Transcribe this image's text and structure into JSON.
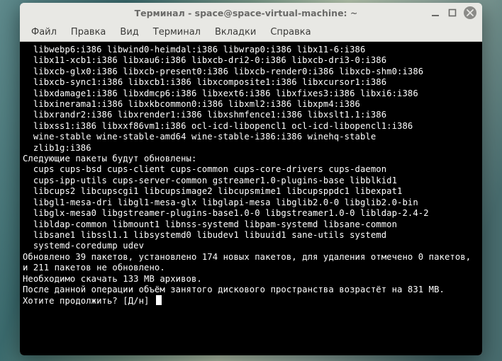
{
  "window": {
    "title": "Терминал - space@space-virtual-machine: ~"
  },
  "menu": {
    "file": "Файл",
    "edit": "Правка",
    "view": "Вид",
    "terminal": "Терминал",
    "tabs": "Вкладки",
    "help": "Справка"
  },
  "term": {
    "l01": "  libwebp6:i386 libwind0-heimdal:i386 libwrap0:i386 libx11-6:i386",
    "l02": "  libx11-xcb1:i386 libxau6:i386 libxcb-dri2-0:i386 libxcb-dri3-0:i386",
    "l03": "  libxcb-glx0:i386 libxcb-present0:i386 libxcb-render0:i386 libxcb-shm0:i386",
    "l04": "  libxcb-sync1:i386 libxcb1:i386 libxcomposite1:i386 libxcursor1:i386",
    "l05": "  libxdamage1:i386 libxdmcp6:i386 libxext6:i386 libxfixes3:i386 libxi6:i386",
    "l06": "  libxinerama1:i386 libxkbcommon0:i386 libxml2:i386 libxpm4:i386",
    "l07": "  libxrandr2:i386 libxrender1:i386 libxshmfence1:i386 libxslt1.1:i386",
    "l08": "  libxss1:i386 libxxf86vm1:i386 ocl-icd-libopencl1 ocl-icd-libopencl1:i386",
    "l09": "  wine-stable wine-stable-amd64 wine-stable-i386:i386 winehq-stable",
    "l10": "  zlib1g:i386",
    "l11": "Следующие пакеты будут обновлены:",
    "l12": "  cups cups-bsd cups-client cups-common cups-core-drivers cups-daemon",
    "l13": "  cups-ipp-utils cups-server-common gstreamer1.0-plugins-base libblkid1",
    "l14": "  libcups2 libcupscgi1 libcupsimage2 libcupsmime1 libcupsppdc1 libexpat1",
    "l15": "  libgl1-mesa-dri libgl1-mesa-glx libglapi-mesa libglib2.0-0 libglib2.0-bin",
    "l16": "  libglx-mesa0 libgstreamer-plugins-base1.0-0 libgstreamer1.0-0 libldap-2.4-2",
    "l17": "  libldap-common libmount1 libnss-systemd libpam-systemd libsane-common",
    "l18": "  libsane1 libssl1.1 libsystemd0 libudev1 libuuid1 sane-utils systemd",
    "l19": "  systemd-coredump udev",
    "l20": "Обновлено 39 пакетов, установлено 174 новых пакетов, для удаления отмечено 0 пакетов, и 211 пакетов не обновлено.",
    "l21": "Необходимо скачать 133 MB архивов.",
    "l22": "После данной операции объём занятого дискового пространства возрастёт на 831 MB.",
    "l23": "Хотите продолжить? [Д/н] "
  }
}
